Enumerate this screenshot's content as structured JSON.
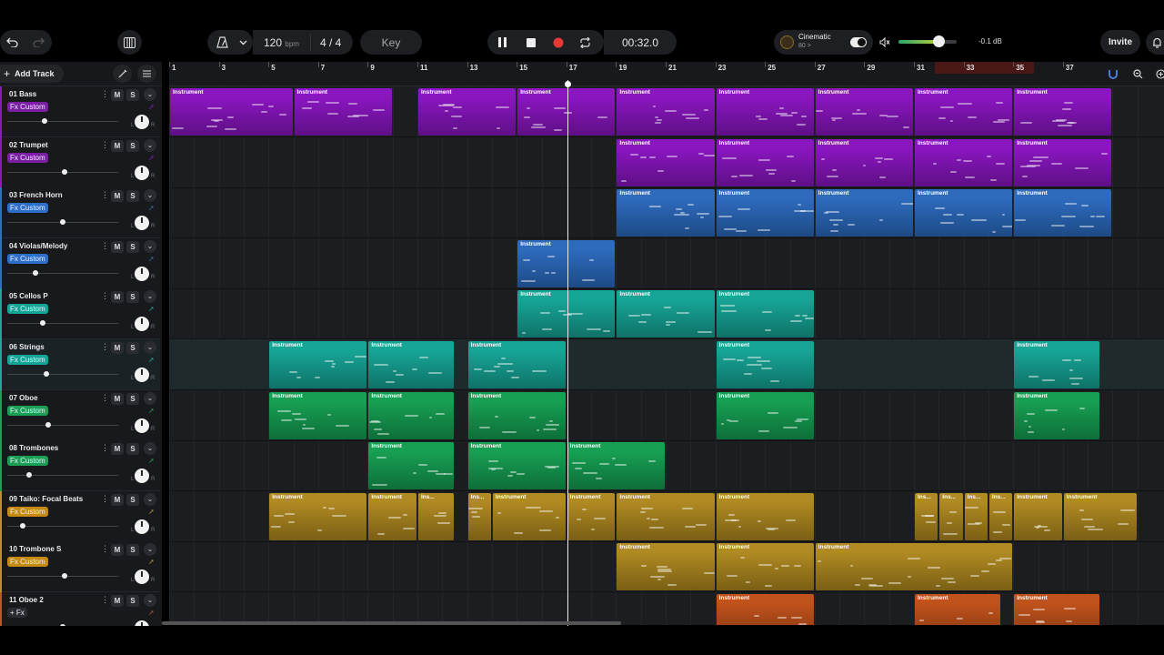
{
  "toolbar": {
    "undo_icon": "undo-icon",
    "redo_icon": "redo-icon",
    "piano_icon": "piano-icon",
    "metronome_icon": "metronome-icon",
    "bpm_value": "120",
    "bpm_unit": "bpm",
    "time_signature": "4 / 4",
    "key_label": "Key",
    "time_display": "00:32.0",
    "preset_name": "Cinematic",
    "preset_sub": "80 >",
    "master_volume_db": "-0.1 dB",
    "master_volume_level": 0.68,
    "invite_label": "Invite",
    "colors": {
      "record": "#e53935",
      "accent": "#f2f2f2"
    }
  },
  "left": {
    "add_track_label": "Add Track",
    "tracks": [
      {
        "name": "01  Bass",
        "fx": "Fx Custom",
        "color": "#8e17c4",
        "fx_bg": "#7b1fa2",
        "vol": 0.34,
        "selected": false
      },
      {
        "name": "02  Trumpet",
        "fx": "Fx Custom",
        "color": "#8e17c4",
        "fx_bg": "#7b1fa2",
        "vol": 0.52,
        "selected": false
      },
      {
        "name": "03  French Horn",
        "fx": "Fx Custom",
        "color": "#2f6fc2",
        "fx_bg": "#2d6ec9",
        "vol": 0.5,
        "selected": false
      },
      {
        "name": "04  Violas/Melody",
        "fx": "Fx Custom",
        "color": "#2f6fc2",
        "fx_bg": "#2d6ec9",
        "vol": 0.25,
        "selected": false
      },
      {
        "name": "05  Cellos P",
        "fx": "Fx Custom",
        "color": "#1aa89a",
        "fx_bg": "#14a596",
        "vol": 0.32,
        "selected": false
      },
      {
        "name": "06  Strings",
        "fx": "Fx Custom",
        "color": "#1aa89a",
        "fx_bg": "#14a596",
        "vol": 0.35,
        "selected": true
      },
      {
        "name": "07  Oboe",
        "fx": "Fx Custom",
        "color": "#19a055",
        "fx_bg": "#1a9f55",
        "vol": 0.37,
        "selected": false
      },
      {
        "name": "08  Trombones",
        "fx": "Fx Custom",
        "color": "#19a055",
        "fx_bg": "#1a9f55",
        "vol": 0.2,
        "selected": false
      },
      {
        "name": "09  Taiko: Focal Beats",
        "fx": "Fx Custom",
        "color": "#b8912a",
        "fx_bg": "#c58a10",
        "vol": 0.14,
        "selected": false
      },
      {
        "name": "10  Trombone S",
        "fx": "Fx Custom",
        "color": "#b8912a",
        "fx_bg": "#c58a10",
        "vol": 0.52,
        "selected": false
      },
      {
        "name": "11  Oboe 2",
        "fx": "+ Fx",
        "color": "#c4561d",
        "fx_bg": "#2a2c31",
        "vol": 0.5,
        "selected": false
      }
    ],
    "mute_label": "M",
    "solo_label": "S",
    "left_label": "L",
    "right_label": "R"
  },
  "ruler": {
    "bars": [
      "1",
      "3",
      "5",
      "7",
      "9",
      "11",
      "13",
      "15",
      "17",
      "19",
      "21",
      "23",
      "25",
      "27",
      "29",
      "31",
      "33",
      "35",
      "37"
    ]
  },
  "arrangement": {
    "clip_label": "Instrument",
    "clip_label_short": "Ins...",
    "lanes": [
      {
        "color": "#8a16c0",
        "dark": "#5e0f85",
        "clips": [
          [
            1,
            11
          ],
          [
            11,
            19
          ],
          [
            21,
            29
          ],
          [
            29,
            37
          ],
          [
            37,
            45
          ],
          [
            45,
            53
          ],
          [
            53,
            61
          ],
          [
            61,
            69
          ],
          [
            69,
            77
          ]
        ]
      },
      {
        "color": "#8a16c0",
        "dark": "#5e0f85",
        "clips": [
          [
            37,
            45
          ],
          [
            45,
            53
          ],
          [
            53,
            61
          ],
          [
            61,
            69
          ],
          [
            69,
            77
          ]
        ]
      },
      {
        "color": "#2e6bbd",
        "dark": "#1d4a86",
        "clips": [
          [
            37,
            45
          ],
          [
            45,
            53
          ],
          [
            53,
            61
          ],
          [
            61,
            69
          ],
          [
            69,
            77
          ]
        ]
      },
      {
        "color": "#2e6bbd",
        "dark": "#1d4a86",
        "clips": [
          [
            29,
            37
          ]
        ]
      },
      {
        "color": "#17a596",
        "dark": "#0f7268",
        "clips": [
          [
            29,
            37
          ],
          [
            37,
            45
          ],
          [
            45,
            53
          ]
        ]
      },
      {
        "color": "#17a596",
        "dark": "#0f7268",
        "clips": [
          [
            9,
            17
          ],
          [
            17,
            24
          ],
          [
            25,
            33
          ],
          [
            45,
            53
          ],
          [
            69,
            76
          ]
        ]
      },
      {
        "color": "#17a053",
        "dark": "#0e6e39",
        "clips": [
          [
            9,
            17
          ],
          [
            17,
            24
          ],
          [
            25,
            33
          ],
          [
            45,
            53
          ],
          [
            69,
            76
          ]
        ]
      },
      {
        "color": "#17a053",
        "dark": "#0e6e39",
        "clips": [
          [
            17,
            24
          ],
          [
            25,
            33
          ],
          [
            33,
            41
          ]
        ]
      },
      {
        "color": "#b08a22",
        "dark": "#7a5f15",
        "clips": [
          [
            9,
            17
          ],
          [
            17,
            21
          ],
          [
            21,
            24
          ],
          [
            25,
            27
          ],
          [
            27,
            33
          ],
          [
            33,
            37
          ],
          [
            37,
            45
          ],
          [
            45,
            53
          ],
          [
            61,
            63
          ],
          [
            63,
            65
          ],
          [
            65,
            67
          ],
          [
            67,
            69
          ],
          [
            69,
            73
          ],
          [
            73,
            79
          ]
        ]
      },
      {
        "color": "#b08a22",
        "dark": "#7a5f15",
        "clips": [
          [
            37,
            45
          ],
          [
            45,
            53
          ],
          [
            53,
            69
          ]
        ]
      },
      {
        "color": "#c0521b",
        "dark": "#853712",
        "clips": [
          [
            45,
            53
          ],
          [
            61,
            68
          ],
          [
            69,
            76
          ]
        ]
      }
    ]
  }
}
